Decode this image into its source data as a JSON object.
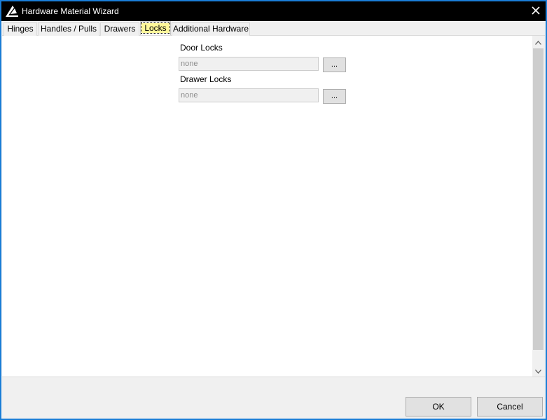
{
  "window": {
    "title": "Hardware Material Wizard",
    "accent_color": "#1a7dd6",
    "titlebar_color": "#000000"
  },
  "tabs": [
    {
      "label": "Hinges",
      "active": false
    },
    {
      "label": "Handles / Pulls",
      "active": false
    },
    {
      "label": "Drawers",
      "active": false
    },
    {
      "label": "Locks",
      "active": true
    },
    {
      "label": "Additional Hardware",
      "active": false
    }
  ],
  "locks": {
    "door": {
      "label": "Door Locks",
      "value": "none",
      "browse_label": "..."
    },
    "drawer": {
      "label": "Drawer Locks",
      "value": "none",
      "browse_label": "..."
    }
  },
  "footer": {
    "ok_label": "OK",
    "cancel_label": "Cancel"
  },
  "icons": {
    "app": "app-logo-icon",
    "close": "close-icon",
    "scroll_up": "chevron-up-icon",
    "scroll_down": "chevron-down-icon"
  }
}
